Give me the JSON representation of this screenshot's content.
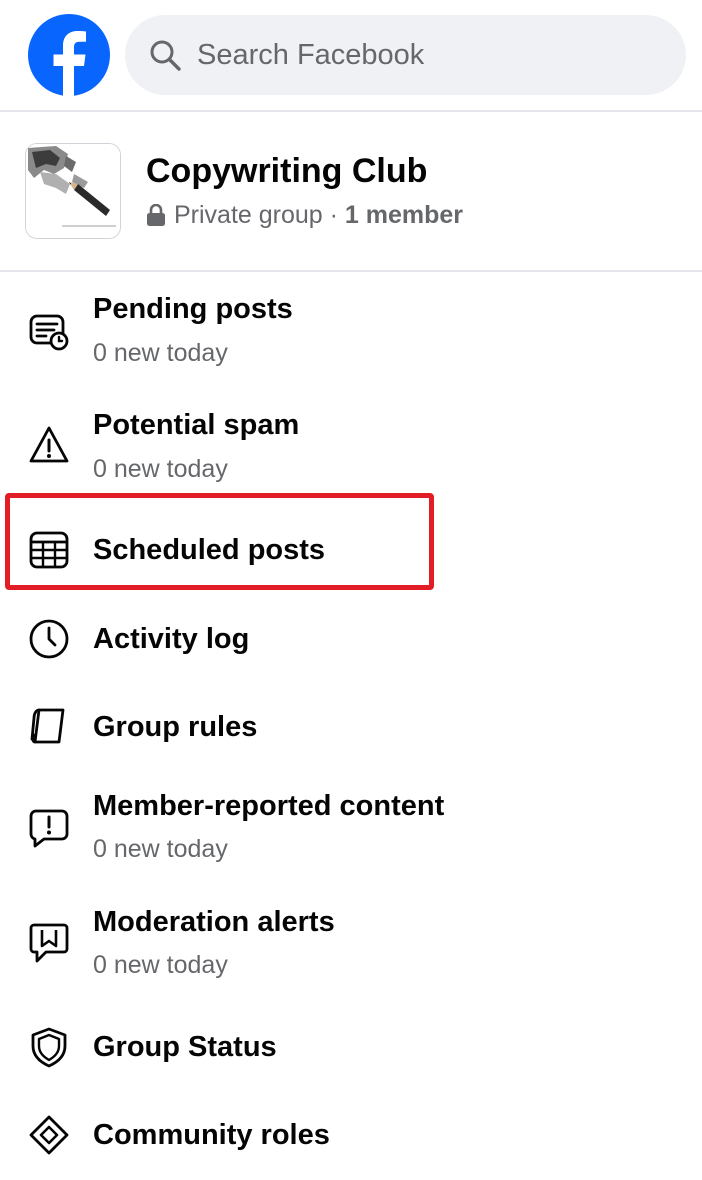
{
  "search": {
    "placeholder": "Search Facebook"
  },
  "group": {
    "name": "Copywriting Club",
    "privacy": "Private group",
    "separator": " · ",
    "members": "1 member"
  },
  "menu": [
    {
      "label": "Pending posts",
      "sub": "0 new today",
      "icon": "pending-posts-icon"
    },
    {
      "label": "Potential spam",
      "sub": "0 new today",
      "icon": "warning-icon"
    },
    {
      "label": "Scheduled posts",
      "icon": "calendar-icon"
    },
    {
      "label": "Activity log",
      "icon": "clock-icon"
    },
    {
      "label": "Group rules",
      "icon": "book-icon"
    },
    {
      "label": "Member-reported content",
      "sub": "0 new today",
      "icon": "report-icon"
    },
    {
      "label": "Moderation alerts",
      "sub": "0 new today",
      "icon": "alert-bookmark-icon"
    },
    {
      "label": "Group Status",
      "icon": "shield-icon"
    },
    {
      "label": "Community roles",
      "icon": "diamond-icon"
    }
  ],
  "colors": {
    "brand": "#0866ff",
    "highlight": "#e21d25",
    "secondary_text": "#65676b"
  }
}
